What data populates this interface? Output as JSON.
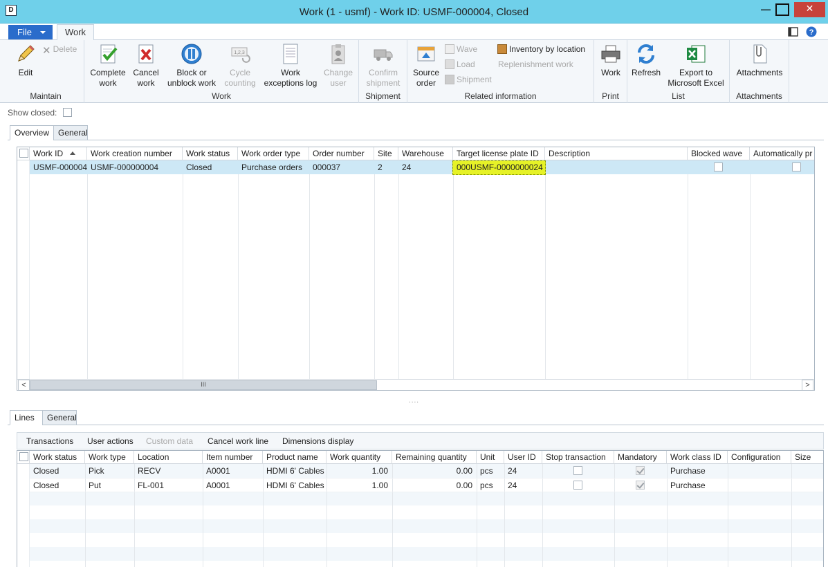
{
  "window": {
    "title": "Work (1 - usmf) - Work ID: USMF-000004, Closed",
    "app_icon_glyph": "D"
  },
  "ribbon_tabs": {
    "file_label": "File",
    "work_label": "Work"
  },
  "ribbon": {
    "maintain": {
      "label": "Maintain",
      "edit": "Edit",
      "delete": "Delete"
    },
    "work": {
      "label": "Work",
      "complete": [
        "Complete",
        "work"
      ],
      "cancel": [
        "Cancel",
        "work"
      ],
      "block": [
        "Block or",
        "unblock work"
      ],
      "cycle": [
        "Cycle",
        "counting"
      ],
      "exceptions": [
        "Work",
        "exceptions log"
      ],
      "change_user": [
        "Change",
        "user"
      ]
    },
    "shipment": {
      "label": "Shipment",
      "confirm": [
        "Confirm",
        "shipment"
      ]
    },
    "related": {
      "label": "Related information",
      "source_order": [
        "Source",
        "order"
      ],
      "wave": "Wave",
      "load": "Load",
      "shipment": "Shipment",
      "inventory_by_location": "Inventory by location",
      "replenishment_work": "Replenishment work"
    },
    "print": {
      "label": "Print",
      "work": "Work"
    },
    "list": {
      "label": "List",
      "refresh": "Refresh",
      "export": [
        "Export to",
        "Microsoft Excel"
      ]
    },
    "attachments": {
      "label": "Attachments",
      "attachments": "Attachments"
    }
  },
  "filter": {
    "show_closed_label": "Show closed:"
  },
  "upper_tabs": [
    "Overview",
    "General"
  ],
  "work_grid": {
    "columns": [
      "Work ID",
      "Work creation number",
      "Work status",
      "Work order type",
      "Order number",
      "Site",
      "Warehouse",
      "Target license plate ID",
      "Description",
      "Blocked wave",
      "Automatically pr"
    ],
    "rows": [
      {
        "work_id": "USMF-000004",
        "work_creation_number": "USMF-000000004",
        "work_status": "Closed",
        "work_order_type": "Purchase orders",
        "order_number": "000037",
        "site": "2",
        "warehouse": "24",
        "target_license_plate_id": "000USMF-0000000024",
        "description": "",
        "blocked_wave": false,
        "automatically": false
      }
    ],
    "scroll_glyph": "III",
    "scroll_left": "<",
    "scroll_right": ">"
  },
  "splitter_glyph": "....",
  "lower_tabs": [
    "Lines",
    "General"
  ],
  "lines_toolbar": {
    "transactions": "Transactions",
    "user_actions": "User actions",
    "custom_data": "Custom data",
    "cancel_work_line": "Cancel work line",
    "dimensions_display": "Dimensions display"
  },
  "lines_grid": {
    "columns": [
      "Work status",
      "Work type",
      "Location",
      "Item number",
      "Product name",
      "Work quantity",
      "Remaining quantity",
      "Unit",
      "User ID",
      "Stop transaction",
      "Mandatory",
      "Work class ID",
      "Configuration",
      "Size"
    ],
    "rows": [
      {
        "work_status": "Closed",
        "work_type": "Pick",
        "location": "RECV",
        "item_number": "A0001",
        "product_name": "HDMI 6' Cables",
        "work_quantity": "1.00",
        "remaining_quantity": "0.00",
        "unit": "pcs",
        "user_id": "24",
        "stop_transaction": false,
        "mandatory": true,
        "work_class_id": "Purchase"
      },
      {
        "work_status": "Closed",
        "work_type": "Put",
        "location": "FL-001",
        "item_number": "A0001",
        "product_name": "HDMI 6' Cables",
        "work_quantity": "1.00",
        "remaining_quantity": "0.00",
        "unit": "pcs",
        "user_id": "24",
        "stop_transaction": false,
        "mandatory": true,
        "work_class_id": "Purchase"
      }
    ]
  },
  "colors": {
    "titlebar": "#6fd0ea",
    "file_button": "#2a6ccb",
    "selected_row": "#cde8f6",
    "highlight": "#e6f227",
    "close_button": "#c7423b"
  }
}
